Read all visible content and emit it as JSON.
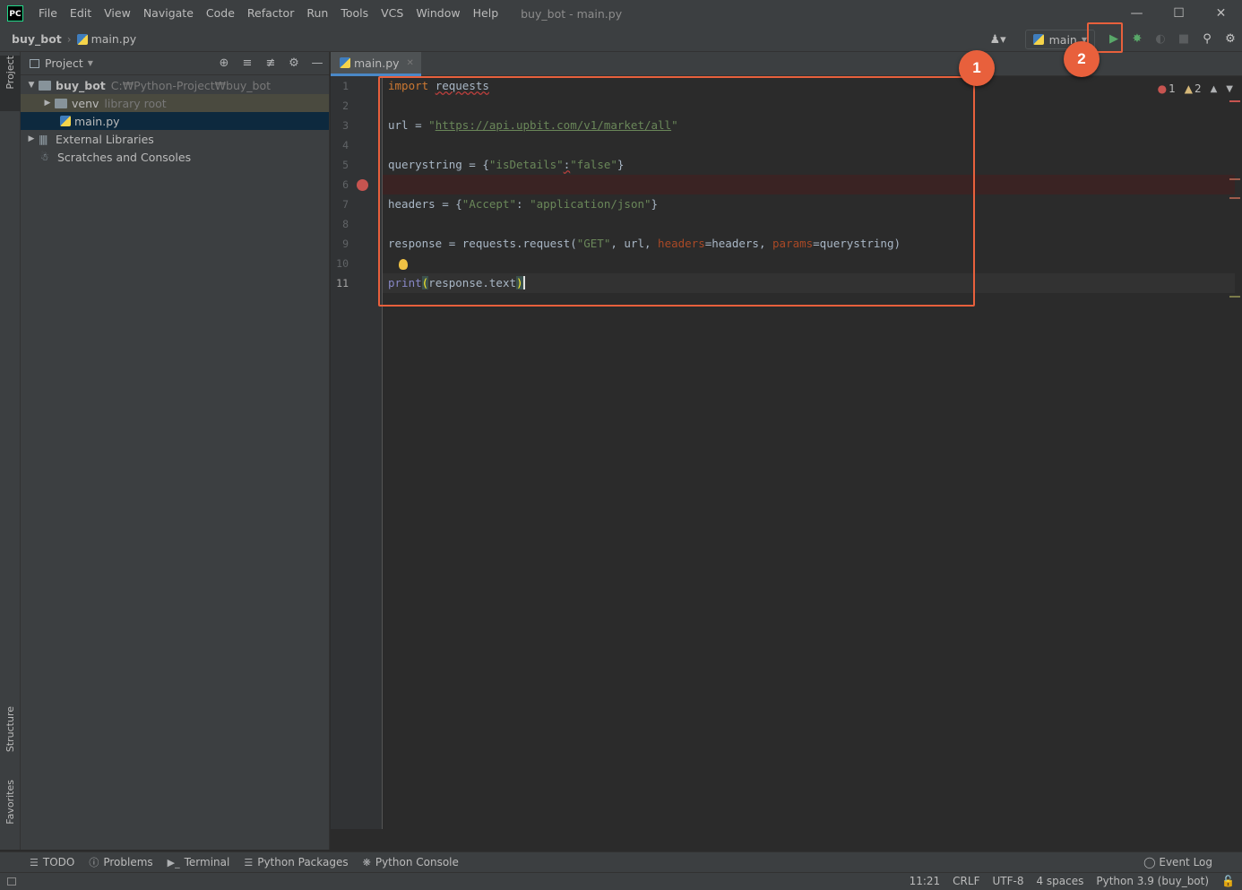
{
  "titlebar": {
    "app_logo": "PC",
    "menu": [
      "File",
      "Edit",
      "View",
      "Navigate",
      "Code",
      "Refactor",
      "Run",
      "Tools",
      "VCS",
      "Window",
      "Help"
    ],
    "window_title": "buy_bot - main.py",
    "controls": [
      "minimize-icon",
      "maximize-icon",
      "close-icon"
    ]
  },
  "navbar": {
    "breadcrumb": [
      "buy_bot",
      "main.py"
    ],
    "run_config": "main"
  },
  "left_strip": {
    "top": "Project",
    "bottom": [
      "Structure",
      "Favorites"
    ]
  },
  "project_panel": {
    "title": "Project",
    "tree": [
      {
        "label": "buy_bot",
        "hint": "C:₩Python-Project₩buy_bot"
      },
      {
        "label": "venv",
        "hint": "library root"
      },
      {
        "label": "main.py",
        "hint": ""
      },
      {
        "label": "External Libraries",
        "hint": ""
      },
      {
        "label": "Scratches and Consoles",
        "hint": ""
      }
    ]
  },
  "editor": {
    "tab": "main.py",
    "line_numbers": [
      "1",
      "2",
      "3",
      "4",
      "5",
      "6",
      "7",
      "8",
      "9",
      "10",
      "11"
    ],
    "code": {
      "l1_kw": "import",
      "l1_mod": "requests",
      "l3_var": "url = ",
      "l3_q1": "\"",
      "l3_url": "https://api.upbit.com/v1/market/all",
      "l3_q2": "\"",
      "l5_var": "querystring = {",
      "l5_key": "\"isDetails\"",
      "l5_colon": ":",
      "l5_val": "\"false\"",
      "l5_end": "}",
      "l7_var": "headers = {",
      "l7_key": "\"Accept\"",
      "l7_sep": ": ",
      "l7_val": "\"application/json\"",
      "l7_end": "}",
      "l9_a": "response = requests.request(",
      "l9_get": "\"GET\"",
      "l9_b": ", url, ",
      "l9_p1": "headers",
      "l9_c": "=headers, ",
      "l9_p2": "params",
      "l9_d": "=querystring)",
      "l11_fn": "print",
      "l11_open": "(",
      "l11_mid": "response.text",
      "l11_close": ")"
    },
    "inspections": {
      "errors": "1",
      "warnings": "2"
    }
  },
  "annotations": {
    "badge1": "1",
    "badge2": "2"
  },
  "bottom_tabs": [
    "TODO",
    "Problems",
    "Terminal",
    "Python Packages",
    "Python Console"
  ],
  "event_log": "Event Log",
  "status": {
    "position": "11:21",
    "line_sep": "CRLF",
    "encoding": "UTF-8",
    "indent": "4 spaces",
    "interpreter": "Python 3.9 (buy_bot)"
  },
  "colors": {
    "accent": "#e8603c",
    "run": "#59a869",
    "breakpoint": "#c75450"
  }
}
